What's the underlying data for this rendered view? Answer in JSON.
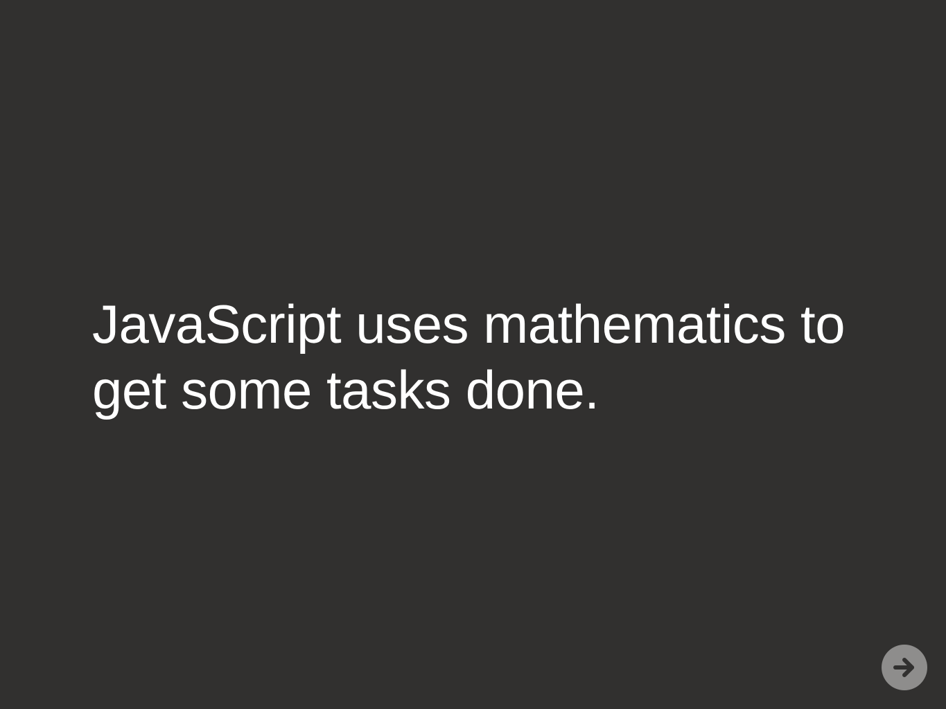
{
  "slide": {
    "lines": [
      "JavaScript uses mathematics to",
      "get some tasks done."
    ],
    "text_color": "#ffffff",
    "background_color": "#31302f"
  },
  "navigation": {
    "next_icon": "arrow-right-icon",
    "button_color": "#8e8d8c",
    "icon_color": "#31302f"
  }
}
